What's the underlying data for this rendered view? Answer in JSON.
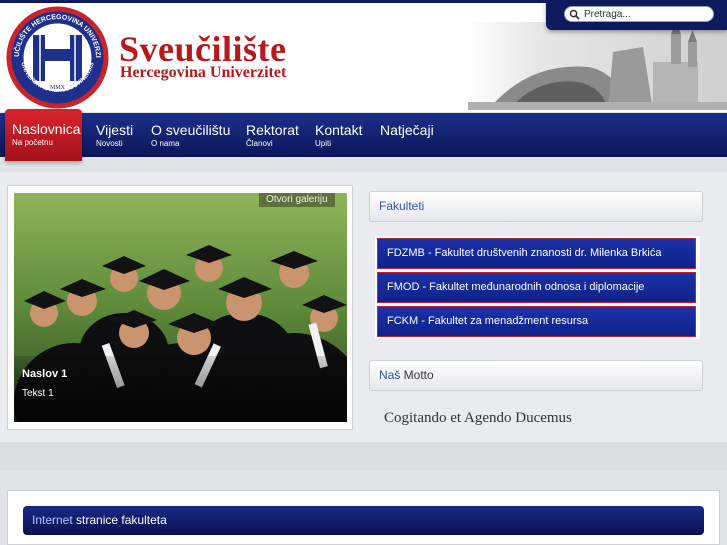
{
  "header": {
    "title": "Sveučilište",
    "subtitle": "Hercegovina Univerzitet",
    "logo_text_top": "SVEUČILIŠTE HERCEGOVINA UNIVERZITET",
    "logo_text_bottom": "UNIVERSITAS HERCEGOVINENSIS",
    "logo_year": "MMX",
    "logo_letter": "H"
  },
  "search": {
    "placeholder": "Pretraga..."
  },
  "nav": [
    {
      "label": "Naslovnica",
      "sub": "Na početnu",
      "active": true
    },
    {
      "label": "Vijesti",
      "sub": "Novosti"
    },
    {
      "label": "O sveučilištu",
      "sub": "O nama"
    },
    {
      "label": "Rektorat",
      "sub": "Članovi"
    },
    {
      "label": "Kontakt",
      "sub": "Upiti"
    },
    {
      "label": "Natječaji",
      "sub": ""
    }
  ],
  "gallery": {
    "open_button": "Otvori galeriju",
    "caption_title": "Naslov 1",
    "caption_text": "Tekst 1"
  },
  "faculties": {
    "heading": "Fakulteti",
    "items": [
      "FDZMB - Fakultet društvenih znanosti dr. Milenka Brkića",
      "FMOD - Fakultet međunarodnih odnosa i diplomacije",
      "FCKM - Fakultet za menadžment resursa"
    ]
  },
  "motto": {
    "heading_highlight": "Naš",
    "heading_rest": " Motto",
    "text": "Cogitando et Agendo Ducemus"
  },
  "bottom": {
    "heading_highlight": "Internet",
    "heading_rest": " stranice fakulteta"
  },
  "colors": {
    "brand_red": "#b8181c",
    "navy": "#0d1a5e",
    "active_red": "#d9232e"
  }
}
